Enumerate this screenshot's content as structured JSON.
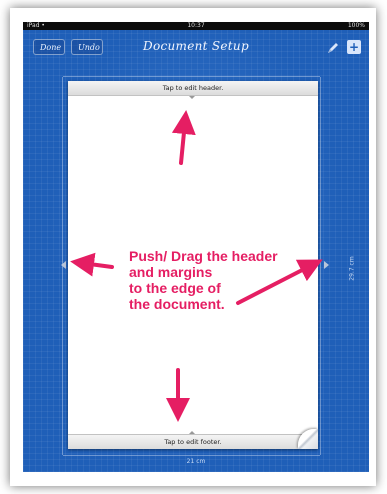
{
  "status_bar": {
    "carrier": "iPad •",
    "time": "10:37",
    "battery": "100%"
  },
  "toolbar": {
    "done_label": "Done",
    "undo_label": "Undo",
    "title": "Document Setup",
    "pen_icon": "pen-icon",
    "add_icon": "add-icon"
  },
  "document": {
    "header_label": "Tap to edit header.",
    "footer_label": "Tap to edit footer.",
    "height_dimension": "29.7 cm",
    "width_dimension": "21 cm"
  },
  "annotation": {
    "lines": [
      "Push/ Drag the header",
      "and margins",
      "to the edge of",
      "the document."
    ],
    "color": "#e51e63"
  },
  "colors": {
    "accent": "#1f5fb8"
  }
}
